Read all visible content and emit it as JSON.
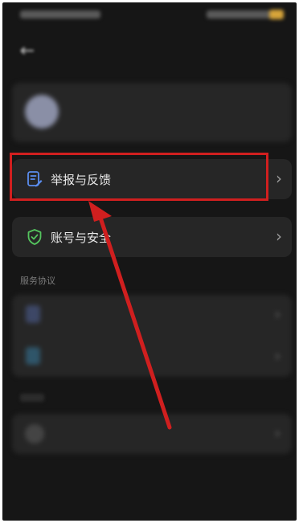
{
  "statusbar": {
    "time": "",
    "indicators": ""
  },
  "header": {
    "back_icon": "back-arrow-icon",
    "title": ""
  },
  "profile": {
    "name": "",
    "subtitle": ""
  },
  "menu": {
    "feedback": {
      "label": "举报与反馈",
      "icon": "document-edit-icon",
      "chevron": "›"
    },
    "security": {
      "label": "账号与安全",
      "icon": "shield-check-icon",
      "chevron": "›"
    }
  },
  "sections": {
    "agreements_title": "服务协议",
    "agreements": [
      {
        "label": "",
        "icon": "document-icon"
      },
      {
        "label": "",
        "icon": "privacy-icon"
      }
    ],
    "other": {
      "label": "",
      "value": "",
      "icon": "settings-circle-icon"
    }
  },
  "annotation": {
    "color": "#d01f1f"
  }
}
